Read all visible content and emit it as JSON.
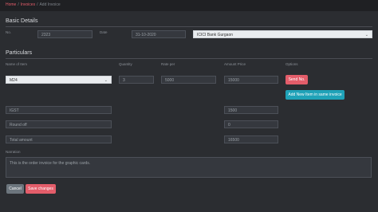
{
  "breadcrumb": {
    "home": "Home",
    "invoices": "Invoices",
    "current": "Add Invoice"
  },
  "basic": {
    "title": "Basic Details",
    "no_label": "No.",
    "no_value": "2323",
    "date_label": "Date",
    "date_value": "31-10-2020",
    "bank_value": "ICICI Bank Gurgaon"
  },
  "particulars": {
    "title": "Particulars",
    "headers": {
      "item": "Name of Item",
      "qty": "Quantity",
      "rate": "Rate per",
      "amount": "Amount Price",
      "options": "Options"
    },
    "row": {
      "item": "M24",
      "qty": "3",
      "rate": "5000",
      "amount": "15000"
    },
    "send_button": "Send No.",
    "add_button": "Add New Item in same invoice",
    "igst_label": "IGST",
    "igst_value": "1500",
    "roundoff_label": "Round off",
    "roundoff_value": "0",
    "total_label": "Total amount",
    "total_value": "16500"
  },
  "narration": {
    "label": "Narration",
    "text": "This is the order invoice for the graphic cards."
  },
  "footer": {
    "cancel": "Cancel",
    "save": "Save changes"
  },
  "colors": {
    "accent": "#e35d6a",
    "teal": "#1fa2b8",
    "background": "#2b2d31"
  }
}
